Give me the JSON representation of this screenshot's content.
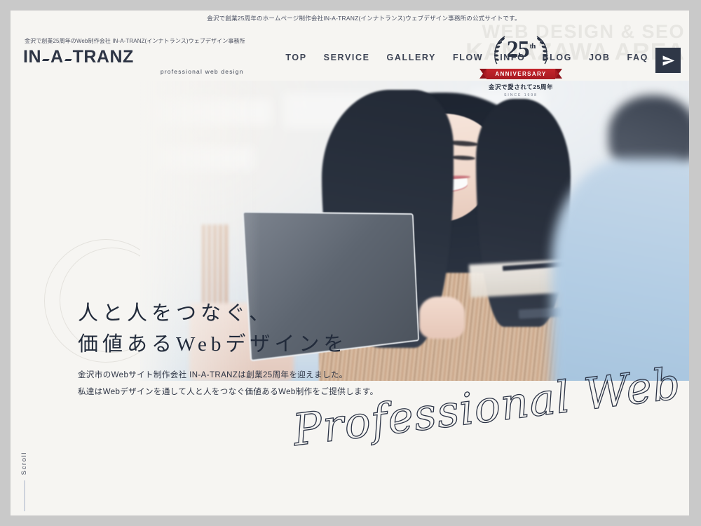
{
  "frame": {
    "border_color": "#c9c9c9",
    "page_bg": "#f6f5f2"
  },
  "topbar": {
    "text": "金沢で創業25周年のホームページ制作会社IN-A-TRANZ(インナトランス)ウェブデザイン事務所の公式サイトです。"
  },
  "watermark": {
    "line1": "WEB DESIGN & SEO",
    "line2": "KANAZAWA AREA"
  },
  "brand": {
    "tagline": "金沢で創業25周年のWeb制作会社  IN-A-TRANZ(インナトランス)ウェブデザイン事務所",
    "logo_part1": "IN",
    "logo_part2": "A",
    "logo_part3": "TRANZ",
    "logo_full": "IN-A-TRANZ",
    "sub": "professional web design"
  },
  "nav": {
    "items": [
      {
        "label": "TOP"
      },
      {
        "label": "SERVICE"
      },
      {
        "label": "GALLERY"
      },
      {
        "label": "FLOW"
      },
      {
        "label": "INFO"
      },
      {
        "label": "BLOG"
      },
      {
        "label": "JOB"
      },
      {
        "label": "FAQ"
      }
    ],
    "contact_icon": "paper-plane-icon",
    "contact_bg": "#2f3747"
  },
  "badge": {
    "number": "25",
    "ordinal": "th",
    "ribbon": "ANNIVERSARY",
    "ribbon_color": "#b92026",
    "jp": "金沢で愛されて25周年",
    "since": "SINCE 1998"
  },
  "hero": {
    "headline_line1": "人と人をつなぐ、",
    "headline_line2": "価値あるWebデザインを",
    "lead_line1": "金沢市のWebサイト制作会社 IN-A-TRANZは創業25周年を迎えました。",
    "lead_line2": "私達はWebデザインを通して人と人をつなぐ価値あるWeb制作をご提供します。",
    "script_text": "Professional Web Design",
    "image_alt": "smiling-woman-with-tablet-at-desk"
  },
  "scroll": {
    "label": "Scroll"
  },
  "colors": {
    "ink": "#2b3345",
    "accent_red": "#b92026",
    "nav_text": "#3c4354",
    "watermark": "#e7e6e2"
  }
}
